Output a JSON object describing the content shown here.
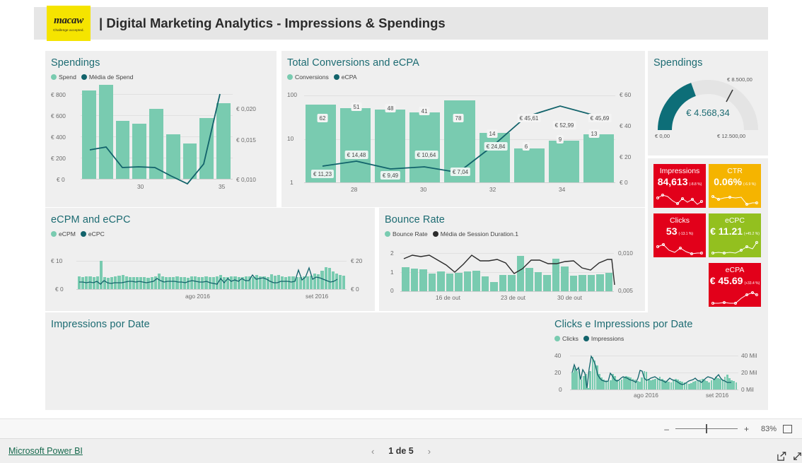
{
  "header": {
    "logo_word": "macaw",
    "logo_tagline": "Challenge accepted.",
    "title": "| Digital Marketing Analytics - Impressions & Spendings"
  },
  "colors": {
    "bar_teal": "#79cbb0",
    "line_teal": "#12636b",
    "line_dark": "#2b2b2b",
    "title_teal": "#1c6b72",
    "tile_bg": "#efefef",
    "logo_yellow": "#f5e400",
    "kpi_red": "#e2001a",
    "kpi_amber": "#f5b400",
    "kpi_green": "#93c01f",
    "gauge_fill": "#0d6e78",
    "gauge_track": "#e4e4e4"
  },
  "tiles": {
    "spendings_bar": {
      "title": "Spendings"
    },
    "conversions": {
      "title": "Total Conversions and eCPA"
    },
    "spendings_gauge": {
      "title": "Spendings"
    },
    "ecpm_ecpc": {
      "title": "eCPM and eCPC"
    },
    "bounce": {
      "title": "Bounce Rate"
    },
    "impressions_date": {
      "title": "Impressions por Date"
    },
    "clicks_impressions": {
      "title": "Clicks e Impressions por Date"
    }
  },
  "gauge": {
    "value_label": "€ 4.568,34",
    "min_label": "€ 0,00",
    "max_label": "€ 12.500,00",
    "target_label": "€ 8.500,00",
    "value": 4568.34,
    "min": 0,
    "max": 12500,
    "target": 8500
  },
  "kpis": [
    {
      "name": "Impressions",
      "value": "84,613",
      "delta": "(-8.8 %)",
      "color": "#e2001a",
      "spark": [
        52,
        38,
        44,
        66,
        82,
        56,
        74,
        60,
        88,
        70,
        64,
        68
      ]
    },
    {
      "name": "CTR",
      "value": "0.06%",
      "delta": "(-6.9 %)",
      "color": "#f5b400",
      "spark": [
        62,
        52,
        48,
        44,
        40,
        36,
        46,
        42,
        40,
        78,
        84,
        72
      ]
    },
    {
      "name": "Clicks",
      "value": "53",
      "delta": "(-13.1 %)",
      "color": "#e2001a",
      "spark": [
        40,
        30,
        26,
        56,
        70,
        50,
        62,
        44,
        76,
        68,
        60,
        62
      ]
    },
    {
      "name": "eCPC",
      "value": "€ 11.21",
      "delta": "(+45.2 %)",
      "color": "#93c01f",
      "spark": [
        82,
        76,
        70,
        74,
        72,
        78,
        74,
        76,
        60,
        42,
        54,
        22
      ]
    },
    {
      "name": "eCPA",
      "value": "€ 45.69",
      "delta": "(+33.4 %)",
      "color": "#e2001a",
      "spark": [
        86,
        84,
        82,
        84,
        84,
        86,
        70,
        52,
        36,
        26,
        22,
        30
      ]
    }
  ],
  "chart_data": [
    {
      "id": "spendings_bar",
      "type": "bar",
      "title": "Spendings",
      "legend": [
        {
          "label": "Spend",
          "color": "#79cbb0",
          "marker": "bar"
        },
        {
          "label": "Média de Spend",
          "color": "#12636b",
          "marker": "line"
        }
      ],
      "categories": [
        "27",
        "28",
        "29",
        "30",
        "31",
        "32",
        "33",
        "34",
        "35"
      ],
      "xticks": [
        {
          "label": "30",
          "index": 3
        },
        {
          "label": "35",
          "index": 8
        }
      ],
      "series": [
        {
          "name": "Spend",
          "type": "bar",
          "axis": "left",
          "values": [
            694,
            740,
            455,
            435,
            548,
            348,
            276,
            476,
            596
          ]
        },
        {
          "name": "Média de Spend",
          "type": "line",
          "axis": "right",
          "values": [
            0.01473,
            0.01494,
            0.01299,
            0.01303,
            0.01299,
            0.01199,
            0.01108,
            0.01355,
            0.02063
          ]
        }
      ],
      "ylabel": "",
      "ylim": [
        0,
        800
      ],
      "yticks": [
        "€ 800",
        "€ 600",
        "€ 400",
        "€ 200",
        "€ 0"
      ],
      "y2lim": [
        0.01,
        0.0205
      ],
      "y2ticks": [
        "€ 0,020",
        "€ 0,015",
        "€ 0,010"
      ],
      "grid": true,
      "legend_position": "top-left"
    },
    {
      "id": "conversions",
      "type": "bar",
      "title": "Total Conversions and eCPA",
      "legend": [
        {
          "label": "Conversions",
          "color": "#79cbb0",
          "marker": "bar"
        },
        {
          "label": "eCPA",
          "color": "#12636b",
          "marker": "line"
        }
      ],
      "categories": [
        "27",
        "28",
        "29",
        "30",
        "31",
        "32",
        "33",
        "34",
        "35"
      ],
      "xticks": [
        {
          "label": "28",
          "index": 1
        },
        {
          "label": "30",
          "index": 3
        },
        {
          "label": "32",
          "index": 5
        },
        {
          "label": "34",
          "index": 7
        }
      ],
      "series": [
        {
          "name": "Conversions",
          "type": "bar",
          "axis": "left",
          "scale": "log",
          "values": [
            62,
            51,
            48,
            41,
            78,
            14,
            6,
            9,
            13
          ],
          "data_labels": [
            "62",
            "51",
            "48",
            "41",
            "78",
            "14",
            "6",
            "9",
            "13"
          ]
        },
        {
          "name": "eCPA",
          "type": "line",
          "axis": "right",
          "values": [
            11.23,
            14.48,
            9.49,
            10.64,
            7.04,
            24.84,
            45.61,
            52.99,
            45.69
          ],
          "data_labels": [
            "€ 11,23",
            "€ 14,48",
            "€ 9,49",
            "€ 10,64",
            "€ 7,04",
            "€ 24,84",
            "€ 45,61",
            "€ 52,99",
            "€ 45,69"
          ]
        }
      ],
      "ylim": [
        1,
        100
      ],
      "yscale": "log",
      "yticks": [
        "100",
        "10",
        "1"
      ],
      "y2lim": [
        0,
        60
      ],
      "y2ticks": [
        "€ 60",
        "€ 40",
        "€ 20",
        "€ 0"
      ],
      "grid": true,
      "legend_position": "top-left"
    },
    {
      "id": "ecpm_ecpc",
      "type": "bar",
      "title": "eCPM and eCPC",
      "legend": [
        {
          "label": "eCPM",
          "color": "#79cbb0",
          "marker": "bar"
        },
        {
          "label": "eCPC",
          "color": "#12636b",
          "marker": "line"
        }
      ],
      "xticks": [
        {
          "label": "ago 2016",
          "pos": 0.44
        },
        {
          "label": "set 2016",
          "pos": 0.88
        }
      ],
      "ylim": [
        0,
        10
      ],
      "yticks": [
        "€ 10",
        "€ 0"
      ],
      "y2lim": [
        0,
        20
      ],
      "y2ticks": [
        "€ 20",
        "€ 0"
      ],
      "series": [
        {
          "name": "eCPM",
          "type": "bar",
          "axis": "left",
          "values": [
            4.6,
            4.3,
            4.5,
            4.4,
            4.2,
            4.5,
            10.0,
            4.2,
            3.9,
            4.2,
            4.6,
            4.8,
            5.0,
            4.4,
            4.3,
            4.3,
            4.2,
            4.3,
            4.2,
            4.1,
            4.2,
            4.4,
            5.6,
            4.4,
            4.3,
            4.3,
            4.2,
            4.4,
            4.3,
            4.2,
            4.1,
            4.4,
            4.6,
            4.3,
            4.2,
            4.4,
            4.3,
            4.2,
            4.4,
            4.9,
            4.2,
            4.3,
            4.5,
            4.4,
            4.2,
            4.3,
            4.5,
            4.6,
            4.3,
            5.0,
            4.6,
            4.4,
            4.3,
            5.2,
            4.8,
            5.0,
            4.6,
            4.3,
            4.5,
            4.6,
            4.3,
            4.2,
            4.4,
            4.6,
            4.8,
            5.4,
            5.2,
            6.6,
            7.8,
            7.4,
            6.2,
            5.4,
            5.0,
            4.8
          ]
        },
        {
          "name": "eCPC",
          "type": "line",
          "axis": "right",
          "values": [
            5.0,
            4.9,
            4.8,
            4.9,
            4.7,
            5.2,
            3.4,
            5.8,
            4.4,
            4.2,
            4.3,
            4.4,
            4.3,
            4.6,
            4.8,
            4.9,
            4.7,
            5.0,
            4.8,
            4.4,
            4.6,
            5.2,
            7.4,
            5.4,
            4.8,
            5.0,
            4.9,
            5.2,
            4.8,
            4.6,
            4.4,
            5.0,
            5.6,
            5.0,
            4.6,
            4.8,
            5.0,
            4.2,
            3.8,
            3.6,
            6.6,
            4.2,
            7.2,
            5.4,
            6.0,
            5.2,
            7.4,
            5.6,
            5.8,
            9.2,
            6.4,
            6.8,
            7.2,
            6.6,
            5.4,
            4.6,
            4.4,
            5.0,
            5.2,
            5.0,
            4.8,
            5.4,
            12.0,
            6.2,
            8.0,
            13.2,
            7.0,
            8.8,
            8.4,
            7.4,
            6.4,
            5.2,
            6.0,
            7.0
          ]
        },
        {
          "note": "dense daily series, ~74 points"
        }
      ],
      "grid": true,
      "legend_position": "top-left"
    },
    {
      "id": "bounce",
      "type": "bar",
      "title": "Bounce Rate",
      "legend": [
        {
          "label": "Bounce Rate",
          "color": "#79cbb0",
          "marker": "bar"
        },
        {
          "label": "Média de Session Duration.1",
          "color": "#2b2b2b",
          "marker": "line"
        }
      ],
      "xticks": [
        {
          "label": "16 de out",
          "pos": 0.25
        },
        {
          "label": "23 de out",
          "pos": 0.55
        },
        {
          "label": "30 de out",
          "pos": 0.8
        }
      ],
      "ylim": [
        0,
        2
      ],
      "yticks": [
        "2",
        "1",
        "0"
      ],
      "y2lim": [
        0.005,
        0.01
      ],
      "y2ticks": [
        "0,010",
        "0,005"
      ],
      "series": [
        {
          "name": "Bounce Rate",
          "type": "bar",
          "axis": "left",
          "values": [
            1.25,
            1.18,
            1.14,
            0.94,
            1.04,
            0.92,
            0.97,
            1.02,
            1.08,
            0.78,
            0.5,
            0.86,
            0.86,
            1.86,
            1.22,
            1.0,
            0.84,
            1.72,
            1.3,
            0.82,
            0.84,
            0.84,
            0.88,
            0.98
          ]
        },
        {
          "name": "Média de Session Duration.1",
          "type": "line",
          "axis": "right",
          "values": [
            0.0089,
            0.0093,
            0.0091,
            0.0093,
            0.0088,
            0.0082,
            0.0075,
            0.0082,
            0.0093,
            0.0087,
            0.0087,
            0.0088,
            0.0084,
            0.0074,
            0.0078,
            0.0088,
            0.0088,
            0.0084,
            0.0084,
            0.0086,
            0.0087,
            0.008,
            0.0078,
            0.0084,
            0.0088,
            0.0088,
            0.0061
          ]
        }
      ],
      "grid": true,
      "legend_position": "top-left"
    },
    {
      "id": "impressions_date",
      "type": "bar",
      "title": "Impressions por Date",
      "note": "tile rendered empty / no data plotted",
      "categories": [],
      "values": []
    },
    {
      "id": "clicks_impressions",
      "type": "bar",
      "title": "Clicks e Impressions por Date",
      "legend": [
        {
          "label": "Clicks",
          "color": "#79cbb0",
          "marker": "bar"
        },
        {
          "label": "Impressions",
          "color": "#12636b",
          "marker": "line"
        }
      ],
      "xticks": [
        {
          "label": "ago 2016",
          "pos": 0.44
        },
        {
          "label": "set 2016",
          "pos": 0.86
        }
      ],
      "ylim": [
        0,
        40
      ],
      "yticks": [
        "40",
        "20",
        "0"
      ],
      "y2lim": [
        0,
        40000
      ],
      "y2ticks": [
        "40 Mil",
        "20 Mil",
        "0 Mil"
      ],
      "series": [
        {
          "name": "Clicks",
          "type": "bar",
          "axis": "left",
          "values": [
            20,
            26,
            22,
            24,
            12,
            16,
            18,
            2,
            22,
            38,
            34,
            28,
            18,
            14,
            12,
            11,
            10,
            11,
            18,
            16,
            12,
            10,
            12,
            14,
            16,
            15,
            14,
            13,
            12,
            10,
            9,
            14,
            22,
            20,
            12,
            10,
            11,
            12,
            13,
            14,
            12,
            11,
            10,
            9,
            8,
            10,
            12,
            11,
            10,
            9,
            8,
            7,
            6,
            7,
            8,
            9,
            10,
            11,
            12,
            10,
            9,
            8,
            10,
            12,
            14,
            13,
            12,
            11,
            14,
            16,
            12,
            10,
            9,
            8
          ]
        },
        {
          "name": "Impressions",
          "type": "line",
          "axis": "right",
          "values": [
            20000,
            29000,
            22000,
            26000,
            12000,
            23000,
            19000,
            1500,
            24000,
            39000,
            35000,
            28000,
            17000,
            13000,
            11000,
            10000,
            9500,
            10000,
            19000,
            16000,
            12000,
            10000,
            11000,
            13000,
            15000,
            14000,
            13000,
            12000,
            11000,
            10000,
            8000,
            13000,
            22000,
            21000,
            13000,
            11000,
            12000,
            13000,
            14000,
            15000,
            13000,
            12000,
            11000,
            10000,
            9000,
            11000,
            13000,
            12000,
            11000,
            10000,
            9000,
            8000,
            7000,
            8000,
            9000,
            10000,
            11000,
            12000,
            13000,
            11000,
            10000,
            9000,
            11000,
            13000,
            15000,
            14000,
            13000,
            12000,
            15000,
            18000,
            14000,
            11000,
            10000,
            9000
          ]
        }
      ],
      "grid": true,
      "legend_position": "top-left"
    }
  ],
  "zoombar": {
    "minus_label": "–",
    "plus_label": "+",
    "percent": "83%",
    "fit_icon": "fit-to-page-icon"
  },
  "statusbar": {
    "brand": "Microsoft Power BI",
    "prev_label": "‹",
    "page_text": "1 de 5",
    "next_label": "›",
    "share_icon": "share-icon",
    "fullscreen_icon": "fullscreen-icon"
  }
}
